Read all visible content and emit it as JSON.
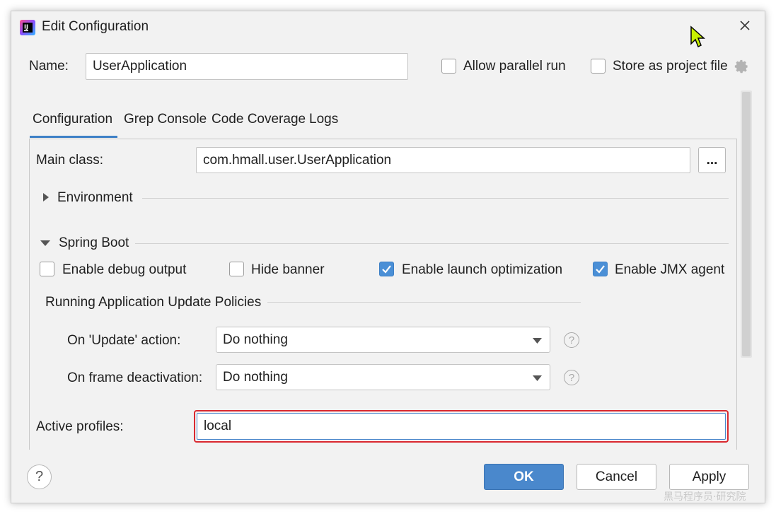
{
  "title": "Edit Configuration",
  "name": {
    "label": "Name:",
    "value": "UserApplication"
  },
  "options": {
    "allow_parallel_run": {
      "label": "Allow parallel run",
      "checked": false
    },
    "store_as_project_file": {
      "label": "Store as project file",
      "checked": false
    }
  },
  "tabs": [
    {
      "label": "Configuration",
      "active": true
    },
    {
      "label": "Grep Console",
      "active": false
    },
    {
      "label": "Code Coverage",
      "active": false
    },
    {
      "label": "Logs",
      "active": false
    }
  ],
  "main_class": {
    "label": "Main class:",
    "value": "com.hmall.user.UserApplication",
    "browse_label": "..."
  },
  "environment": {
    "label": "Environment",
    "expanded": false
  },
  "spring_boot": {
    "label": "Spring Boot",
    "expanded": true,
    "checkboxes": [
      {
        "label": "Enable debug output",
        "checked": false
      },
      {
        "label": "Hide banner",
        "checked": false
      },
      {
        "label": "Enable launch optimization",
        "checked": true
      },
      {
        "label": "Enable JMX agent",
        "checked": true
      }
    ],
    "policies": {
      "heading": "Running Application Update Policies",
      "on_update": {
        "label": "On 'Update' action:",
        "value": "Do nothing"
      },
      "on_frame_deactivation": {
        "label": "On frame deactivation:",
        "value": "Do nothing"
      }
    }
  },
  "active_profiles": {
    "label": "Active profiles:",
    "value": "local",
    "highlight_color": "#d9282f"
  },
  "buttons": {
    "help": "?",
    "ok": "OK",
    "cancel": "Cancel",
    "apply": "Apply"
  },
  "watermark": "黑马程序员·研究院",
  "colors": {
    "accent": "#4a88cc",
    "checkbox_checked": "#4a8fd6",
    "highlight": "#d9282f"
  }
}
